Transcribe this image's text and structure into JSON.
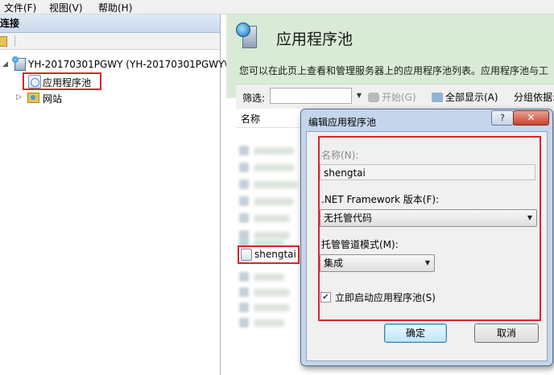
{
  "menubar": {
    "items": [
      "文件(F)",
      "视图(V)",
      "帮助(H)"
    ]
  },
  "left_panel": {
    "header": "连接",
    "server_node": "YH-20170301PGWY (YH-20170301PGWY\\",
    "app_pools_node": "应用程序池",
    "sites_node": "网站"
  },
  "right_panel": {
    "title": "应用程序池",
    "description": "您可以在此页上查看和管理服务器上的应用程序池列表。应用程序池与工",
    "filter_label": "筛选:",
    "filter_value": "",
    "start_button": "开始(G)",
    "show_all_button": "全部显示(A)",
    "group_by_label": "分组依据:",
    "column_name": "名称",
    "visible_items": [
      "shengtai"
    ]
  },
  "dialog": {
    "title": "编辑应用程序池",
    "help_label": "?",
    "close_label": "✕",
    "name_label": "名称(N):",
    "name_value": "shengtai",
    "framework_label": ".NET Framework 版本(F):",
    "framework_value": "无托管代码",
    "pipeline_label": "托管管道模式(M):",
    "pipeline_value": "集成",
    "autostart_label": "立即启动应用程序池(S)",
    "autostart_checked": true,
    "ok_label": "确定",
    "cancel_label": "取消"
  },
  "colors": {
    "header_green": "#d9ebd6",
    "highlight_red": "#d9242a",
    "dialog_frame": "#c5d6ec"
  }
}
